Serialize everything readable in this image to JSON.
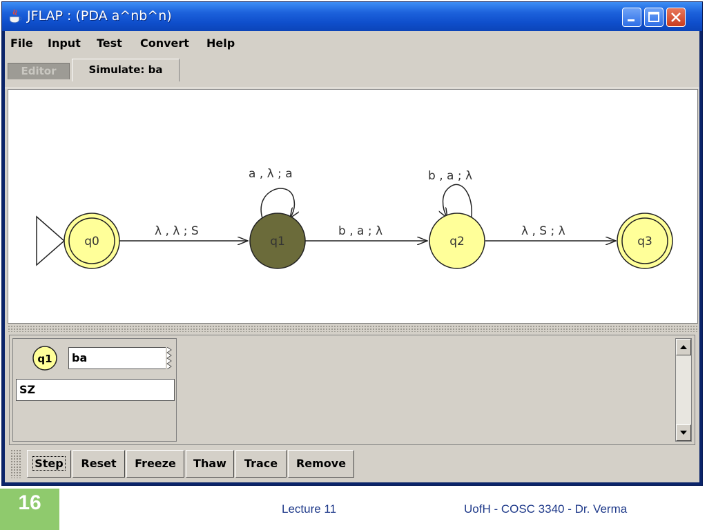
{
  "window": {
    "title": "JFLAP : (PDA a^nb^n)"
  },
  "menu": [
    "File",
    "Input",
    "Test",
    "Convert",
    "Help"
  ],
  "tabs": {
    "editor": "Editor",
    "simulate": "Simulate: ba"
  },
  "automaton": {
    "states": [
      {
        "id": "q0",
        "label": "q0",
        "initial": true,
        "final": true,
        "highlighted": false
      },
      {
        "id": "q1",
        "label": "q1",
        "initial": false,
        "final": false,
        "highlighted": true
      },
      {
        "id": "q2",
        "label": "q2",
        "initial": false,
        "final": false,
        "highlighted": false
      },
      {
        "id": "q3",
        "label": "q3",
        "initial": false,
        "final": true,
        "highlighted": false
      }
    ],
    "transitions": [
      {
        "from": "q0",
        "to": "q1",
        "label": "λ , λ ; S"
      },
      {
        "from": "q1",
        "to": "q1",
        "label": "a , λ ; a"
      },
      {
        "from": "q1",
        "to": "q2",
        "label": "b , a ; λ"
      },
      {
        "from": "q2",
        "to": "q2",
        "label": "b , a ; λ"
      },
      {
        "from": "q2",
        "to": "q3",
        "label": "λ , S ; λ"
      }
    ]
  },
  "configuration": {
    "state": "q1",
    "input_remaining": "ba",
    "stack": "SZ"
  },
  "buttons": [
    "Step",
    "Reset",
    "Freeze",
    "Thaw",
    "Trace",
    "Remove"
  ],
  "footer": {
    "slide_number": "16",
    "center": "Lecture 11",
    "right": "UofH - COSC 3340 - Dr. Verma"
  },
  "colors": {
    "state_fill": "#ffff99",
    "highlight_fill": "#6b6b3a",
    "slide_accent": "#8fca6d",
    "footer_text": "#1f3a8a"
  }
}
